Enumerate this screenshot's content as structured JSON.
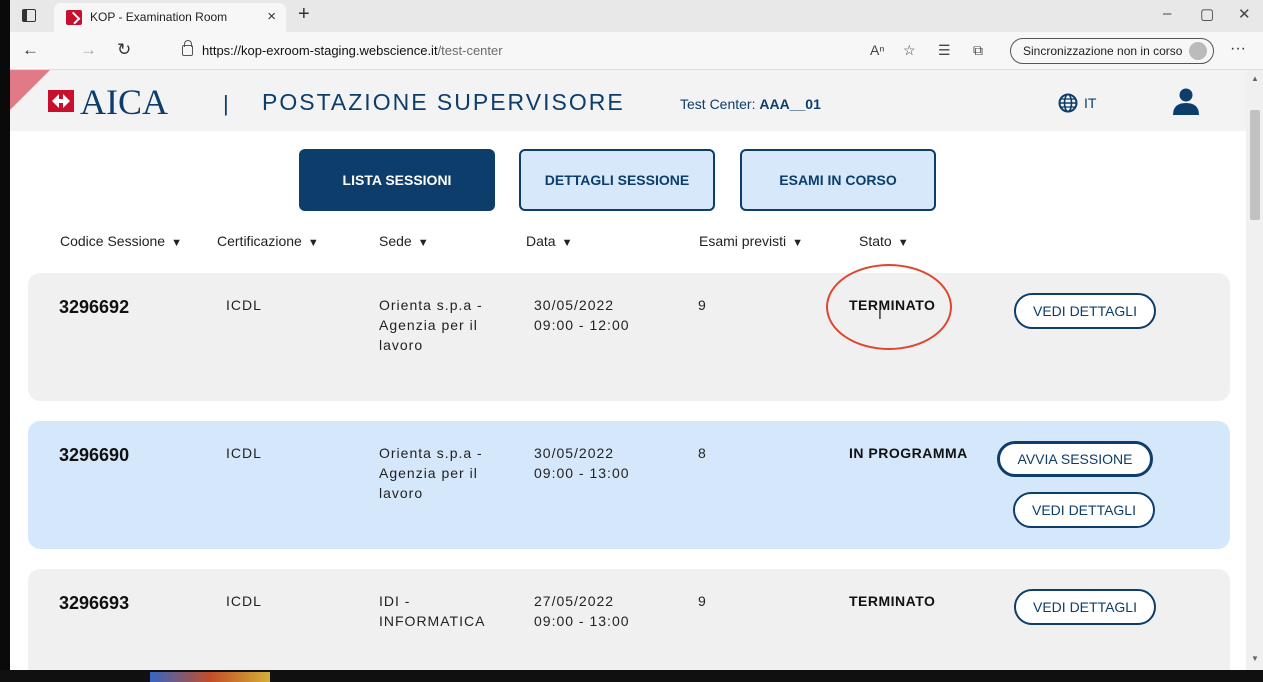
{
  "browser": {
    "tab_title": "KOP - Examination Room",
    "tab_close": "×",
    "new_tab": "+",
    "url_host": "https://kop-exroom-staging.webscience.it",
    "url_path": "/test-center",
    "sync_label": "Sincronizzazione non in corso",
    "more": "···",
    "win_min": "–",
    "win_max": "▢",
    "win_close": "✕",
    "icons": [
      "read-aloud-icon",
      "add-favorite-icon",
      "favorites-icon",
      "collections-icon"
    ]
  },
  "header": {
    "logo_text": "AICA",
    "separator": "|",
    "title": "POSTAZIONE SUPERVISORE",
    "test_center_label": "Test Center:",
    "test_center_value": "AAA__01",
    "language": "IT"
  },
  "tabs": [
    {
      "label": "LISTA SESSIONI",
      "active": true
    },
    {
      "label": "DETTAGLI SESSIONE",
      "active": false
    },
    {
      "label": "ESAMI IN CORSO",
      "active": false
    }
  ],
  "columns": [
    "Codice Sessione",
    "Certificazione",
    "Sede",
    "Data",
    "Esami previsti",
    "Stato"
  ],
  "rows": [
    {
      "code": "3296692",
      "cert": "ICDL",
      "sede": "Orienta s.p.a - Agenzia per il lavoro",
      "date": "30/05/2022",
      "time": "09:00 - 12:00",
      "esami": "9",
      "stato": "TERMINATO",
      "buttons": [
        "VEDI DETTAGLI"
      ]
    },
    {
      "code": "3296690",
      "cert": "ICDL",
      "sede": "Orienta s.p.a - Agenzia per il lavoro",
      "date": "30/05/2022",
      "time": "09:00 - 13:00",
      "esami": "8",
      "stato": "IN PROGRAMMA",
      "buttons": [
        "AVVIA SESSIONE",
        "VEDI DETTAGLI"
      ]
    },
    {
      "code": "3296693",
      "cert": "ICDL",
      "sede": "IDI - INFORMATICA",
      "date": "27/05/2022",
      "time": "09:00 - 13:00",
      "esami": "9",
      "stato": "TERMINATO",
      "buttons": [
        "VEDI DETTAGLI"
      ]
    }
  ],
  "colors": {
    "brand": "#0d3d6b",
    "highlight_row": "#d5e8fb",
    "annotation": "#e0452e",
    "logo_red": "#c8102e"
  }
}
